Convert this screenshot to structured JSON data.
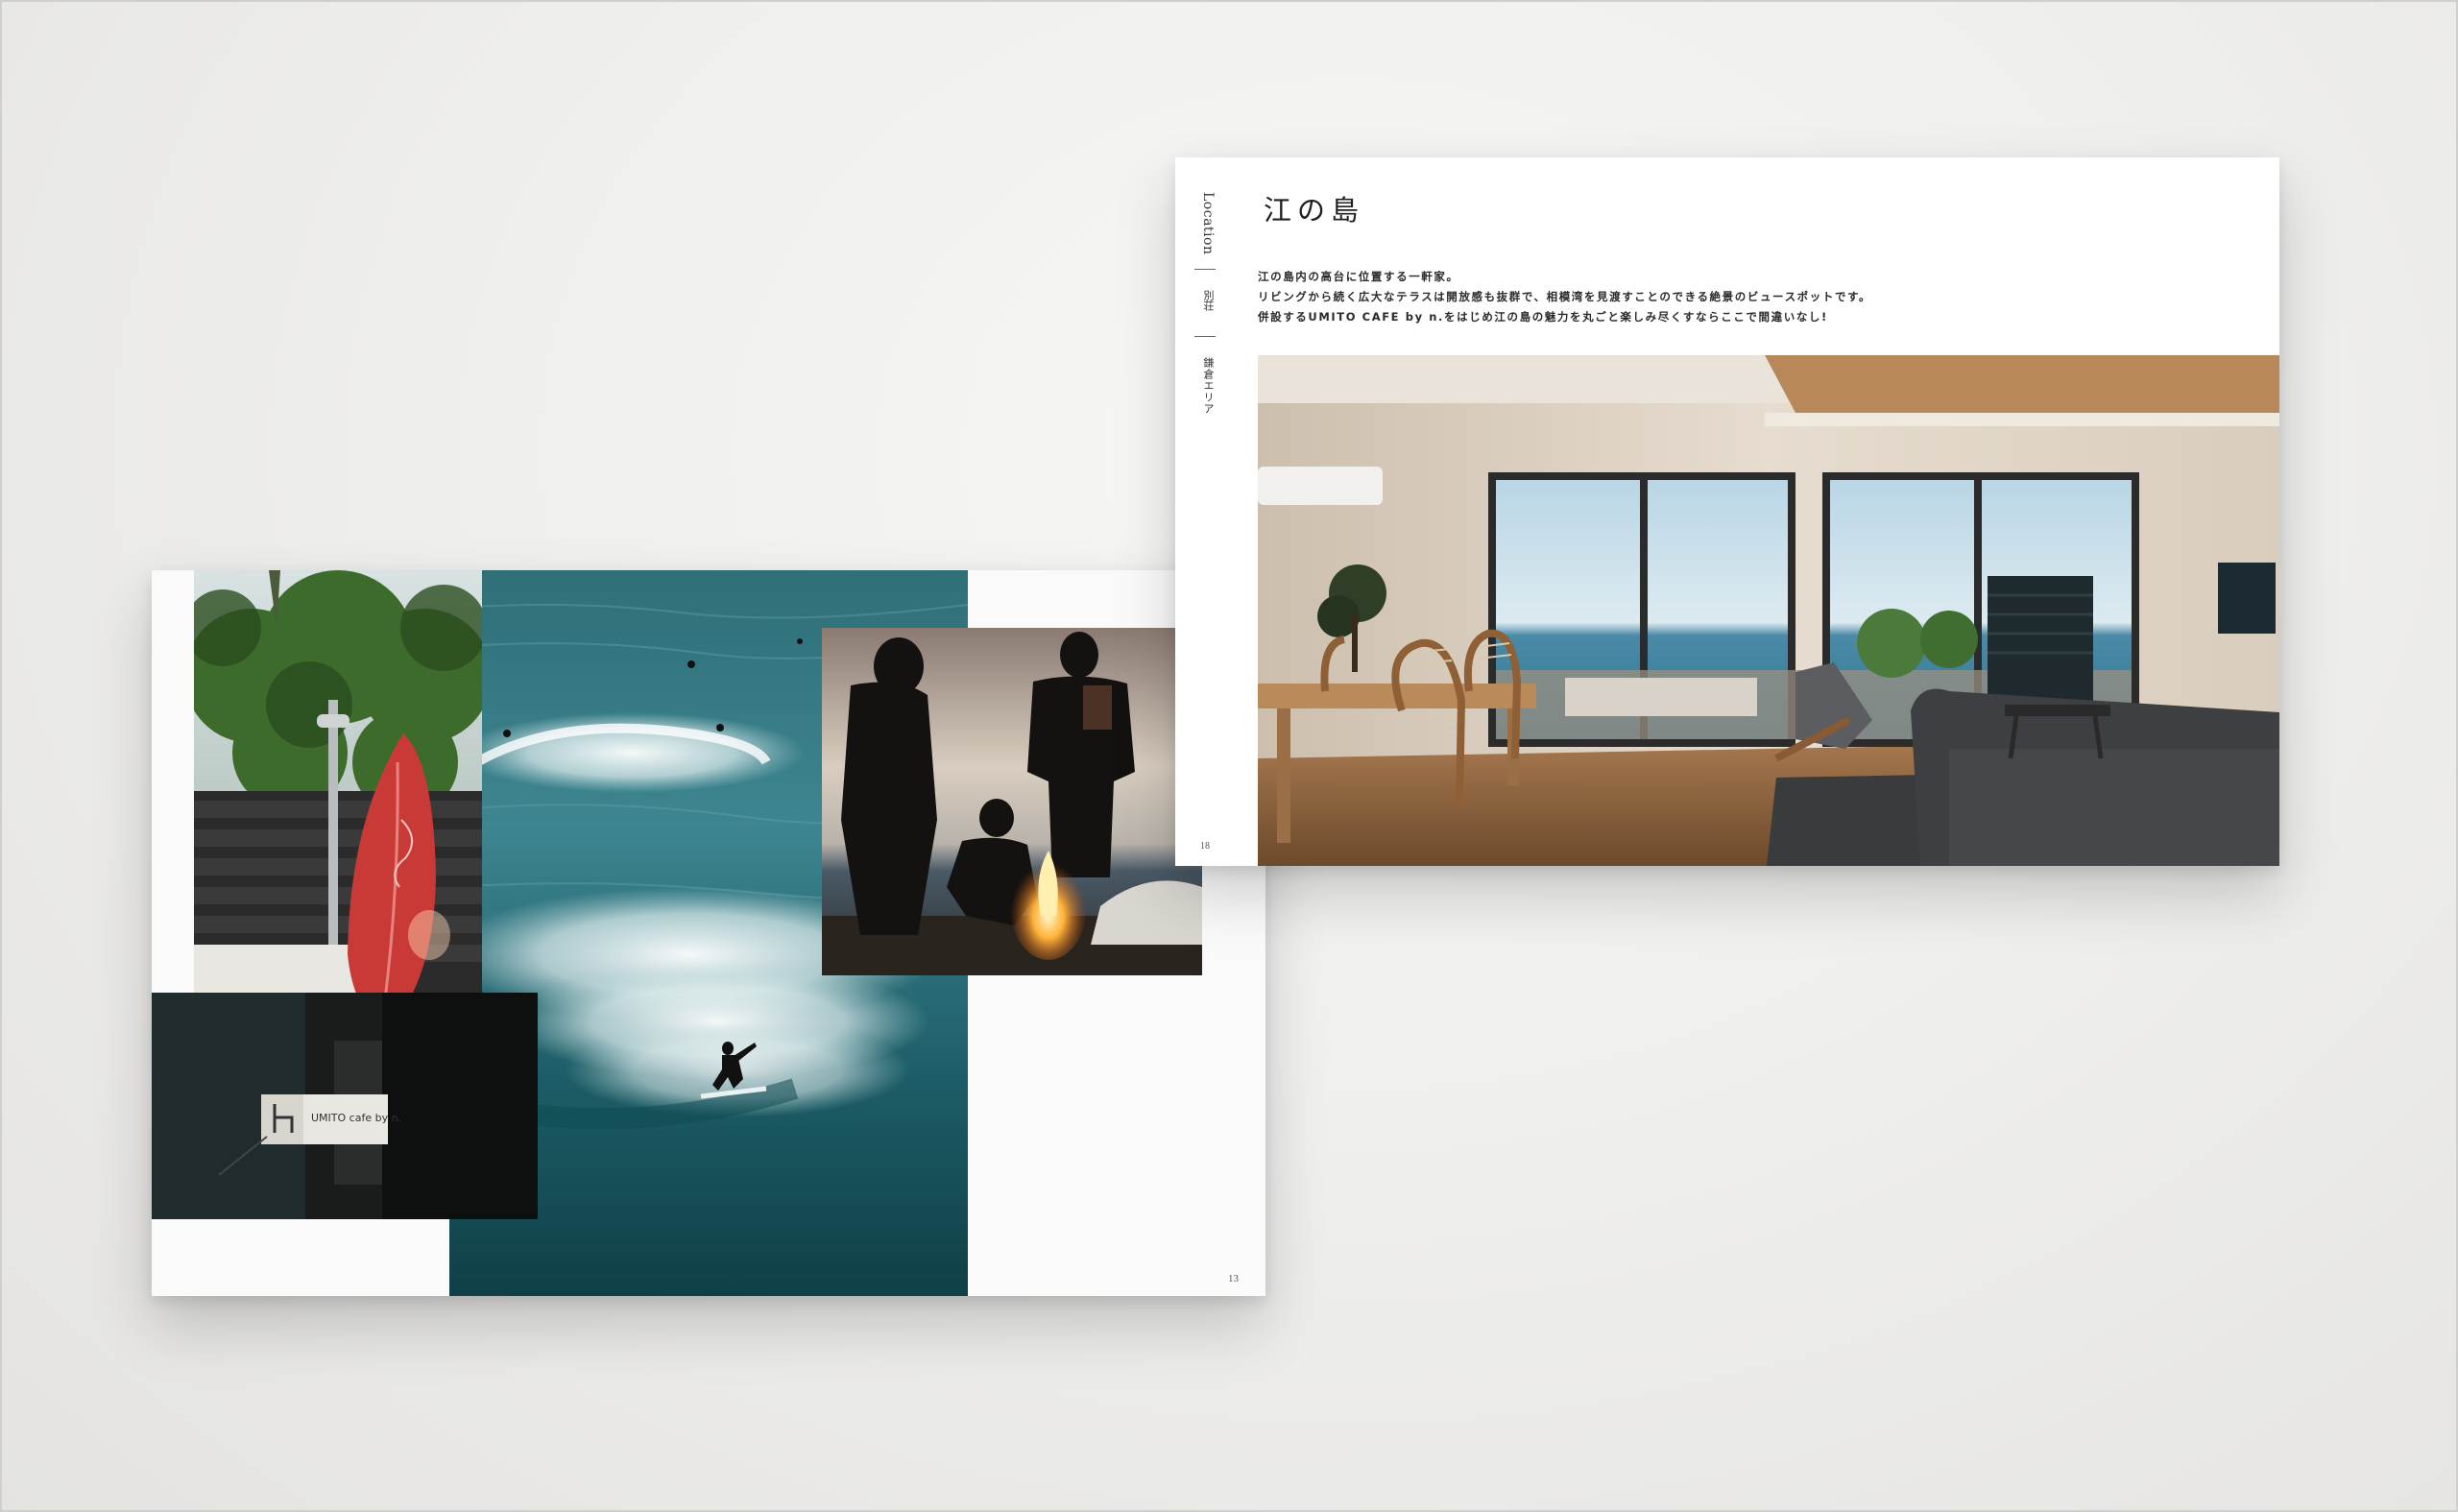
{
  "left_spread": {
    "photos": {
      "shower": "outdoor-shower-with-red-surfboard-photo",
      "sign": "umito-cafe-sign-photo",
      "waves": "surfer-on-wave-aerial-photo",
      "campfire": "beach-campfire-photo"
    },
    "sign_text": "UMITO cafe by n.",
    "page_number": "13"
  },
  "right_spread": {
    "side_nav": {
      "location": "Location",
      "besso": "別荘",
      "area": "鎌倉エリア"
    },
    "page_number": "18",
    "title": "江の島",
    "description": [
      "江の島内の高台に位置する一軒家。",
      "リビングから続く広大なテラスは開放感も抜群で、相模湾を見渡すことのできる絶景のビュースポットです。",
      "併設するUMITO CAFE by n.をはじめ江の島の魅力を丸ごと楽しみ尽くすならここで間違いなし!"
    ],
    "photo": "ocean-view-living-room-photo"
  },
  "colors": {
    "background": "#efefed",
    "paper": "#ffffff",
    "ocean_teal": "#1f6a72",
    "surfboard_red": "#c93a36"
  }
}
